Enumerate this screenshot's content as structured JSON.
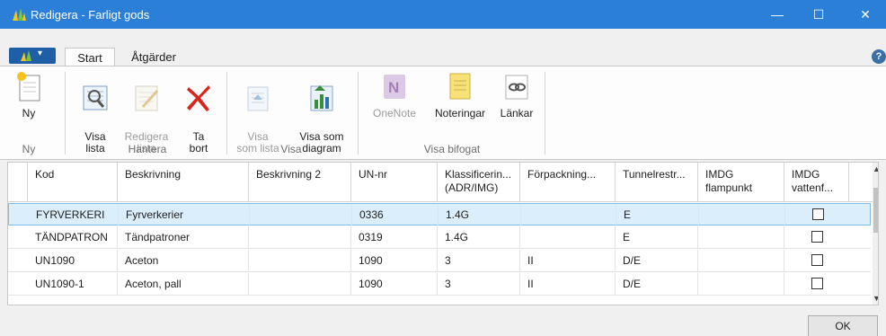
{
  "window": {
    "title": "Redigera - Farligt gods",
    "controls": {
      "minimize": "—",
      "maximize": "☐",
      "close": "✕"
    }
  },
  "tabs": [
    {
      "label": "Start",
      "active": true
    },
    {
      "label": "Åtgärder",
      "active": false
    }
  ],
  "help_glyph": "?",
  "ribbon": {
    "groups": [
      {
        "label": "Ny",
        "buttons": [
          {
            "label": "Ny",
            "icon": "new-document-icon",
            "enabled": true
          }
        ]
      },
      {
        "label": "Hantera",
        "buttons": [
          {
            "label": "Visa\nlista",
            "icon": "view-list-icon",
            "enabled": true
          },
          {
            "label": "Redigera\nlista",
            "icon": "edit-list-icon",
            "enabled": false
          },
          {
            "label": "Ta\nbort",
            "icon": "delete-icon",
            "enabled": true
          }
        ]
      },
      {
        "label": "Visa",
        "buttons": [
          {
            "label": "Visa\nsom lista",
            "icon": "show-as-list-icon",
            "enabled": false
          },
          {
            "label": "Visa som\ndiagram",
            "icon": "show-as-chart-icon",
            "enabled": true
          }
        ]
      },
      {
        "label": "Visa bifogat",
        "buttons": [
          {
            "label": "OneNote",
            "icon": "onenote-icon",
            "enabled": false
          },
          {
            "label": "Noteringar",
            "icon": "notes-icon",
            "enabled": true
          },
          {
            "label": "Länkar",
            "icon": "links-icon",
            "enabled": true
          }
        ]
      }
    ]
  },
  "table": {
    "columns": [
      "Kod",
      "Beskrivning",
      "Beskrivning 2",
      "UN-nr",
      "Klassificerin...\n(ADR/IMG)",
      "Förpackning...",
      "Tunnelrestr...",
      "IMDG\nflampunkt",
      "IMDG\nvattenf..."
    ],
    "rows": [
      {
        "kod": "FYRVERKERI",
        "beskrivning": "Fyrverkerier",
        "beskrivning2": "",
        "un_nr": "0336",
        "klass": "1.4G",
        "forpackning": "",
        "tunnel": "E",
        "flampunkt": "",
        "vattenf": false,
        "selected": true
      },
      {
        "kod": "TÄNDPATRON",
        "beskrivning": "Tändpatroner",
        "beskrivning2": "",
        "un_nr": "0319",
        "klass": "1.4G",
        "forpackning": "",
        "tunnel": "E",
        "flampunkt": "",
        "vattenf": false,
        "selected": false
      },
      {
        "kod": "UN1090",
        "beskrivning": "Aceton",
        "beskrivning2": "",
        "un_nr": "1090",
        "klass": "3",
        "forpackning": "II",
        "tunnel": "D/E",
        "flampunkt": "",
        "vattenf": false,
        "selected": false
      },
      {
        "kod": "UN1090-1",
        "beskrivning": "Aceton, pall",
        "beskrivning2": "",
        "un_nr": "1090",
        "klass": "3",
        "forpackning": "II",
        "tunnel": "D/E",
        "flampunkt": "",
        "vattenf": false,
        "selected": false
      }
    ]
  },
  "footer": {
    "ok_label": "OK"
  },
  "colors": {
    "titlebar": "#2b7fd6",
    "selection": "#dbeefb",
    "delete_red": "#d9261c"
  }
}
